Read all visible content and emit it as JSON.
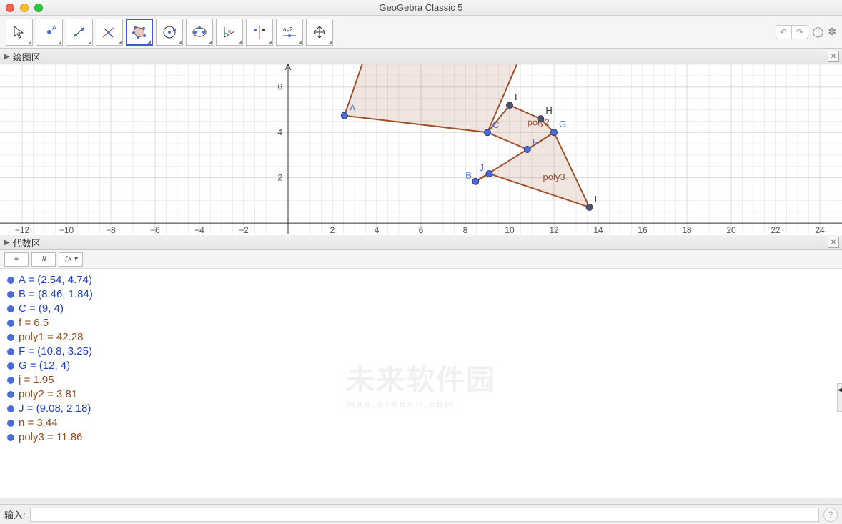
{
  "window": {
    "title": "GeoGebra Classic 5"
  },
  "panels": {
    "graphics": "绘图区",
    "algebra": "代数区"
  },
  "input": {
    "label": "输入:",
    "placeholder": ""
  },
  "axis": {
    "x_ticks": [
      -12,
      -10,
      -8,
      -6,
      -4,
      -2,
      2,
      4,
      6,
      8,
      10,
      12,
      14,
      16,
      18,
      20,
      22,
      24
    ],
    "y_ticks": [
      2,
      4,
      6
    ]
  },
  "chart_data": {
    "type": "scatter",
    "xlim": [
      -13,
      25
    ],
    "ylim": [
      -0.5,
      7
    ],
    "points": [
      {
        "name": "A",
        "x": 2.54,
        "y": 4.74,
        "color": "#4a6bd8"
      },
      {
        "name": "B",
        "x": 8.46,
        "y": 1.84,
        "color": "#4a6bd8"
      },
      {
        "name": "C",
        "x": 9,
        "y": 4,
        "color": "#4a6bd8"
      },
      {
        "name": "F",
        "x": 10.8,
        "y": 3.25,
        "color": "#4a6bd8"
      },
      {
        "name": "G",
        "x": 12,
        "y": 4,
        "color": "#4a6bd8"
      },
      {
        "name": "H",
        "x": 11.4,
        "y": 4.6,
        "color": "#555"
      },
      {
        "name": "I",
        "x": 10,
        "y": 5.2,
        "color": "#555"
      },
      {
        "name": "J",
        "x": 9.08,
        "y": 2.18,
        "color": "#4a6bd8"
      },
      {
        "name": "L",
        "x": 13.6,
        "y": 0.7,
        "color": "#555"
      }
    ],
    "polygons": [
      {
        "name": "poly1",
        "vertices": [
          "A",
          "C"
        ],
        "label_pos": {
          "x": 7.5,
          "y": 7.2
        },
        "top_open": true,
        "extra": [
          {
            "x": 3.4,
            "y": 7.5
          },
          {
            "x": 10.4,
            "y": 7.5
          }
        ]
      },
      {
        "name": "poly2",
        "vertices": [
          "C",
          "I",
          "H",
          "G",
          "F"
        ],
        "label_pos": {
          "x": 10.8,
          "y": 4.3
        }
      },
      {
        "name": "poly3",
        "vertices": [
          "B",
          "F",
          "G",
          "L",
          "J"
        ],
        "label_pos": {
          "x": 11.5,
          "y": 1.9
        }
      }
    ]
  },
  "algebra_items": [
    {
      "kind": "pt",
      "text": "A = (2.54, 4.74)"
    },
    {
      "kind": "pt",
      "text": "B = (8.46, 1.84)"
    },
    {
      "kind": "pt",
      "text": "C = (9, 4)"
    },
    {
      "kind": "obj",
      "text": "f = 6.5"
    },
    {
      "kind": "obj",
      "text": "poly1 = 42.28"
    },
    {
      "kind": "pt",
      "text": "F = (10.8, 3.25)"
    },
    {
      "kind": "pt",
      "text": "G = (12, 4)"
    },
    {
      "kind": "obj",
      "text": "j = 1.95"
    },
    {
      "kind": "obj",
      "text": "poly2 = 3.81"
    },
    {
      "kind": "pt",
      "text": "J = (9.08, 2.18)"
    },
    {
      "kind": "obj",
      "text": "n = 3.44"
    },
    {
      "kind": "obj",
      "text": "poly3 = 11.86"
    }
  ],
  "watermark": {
    "main": "未来软件园",
    "sub": "mac.orsoon.com"
  }
}
